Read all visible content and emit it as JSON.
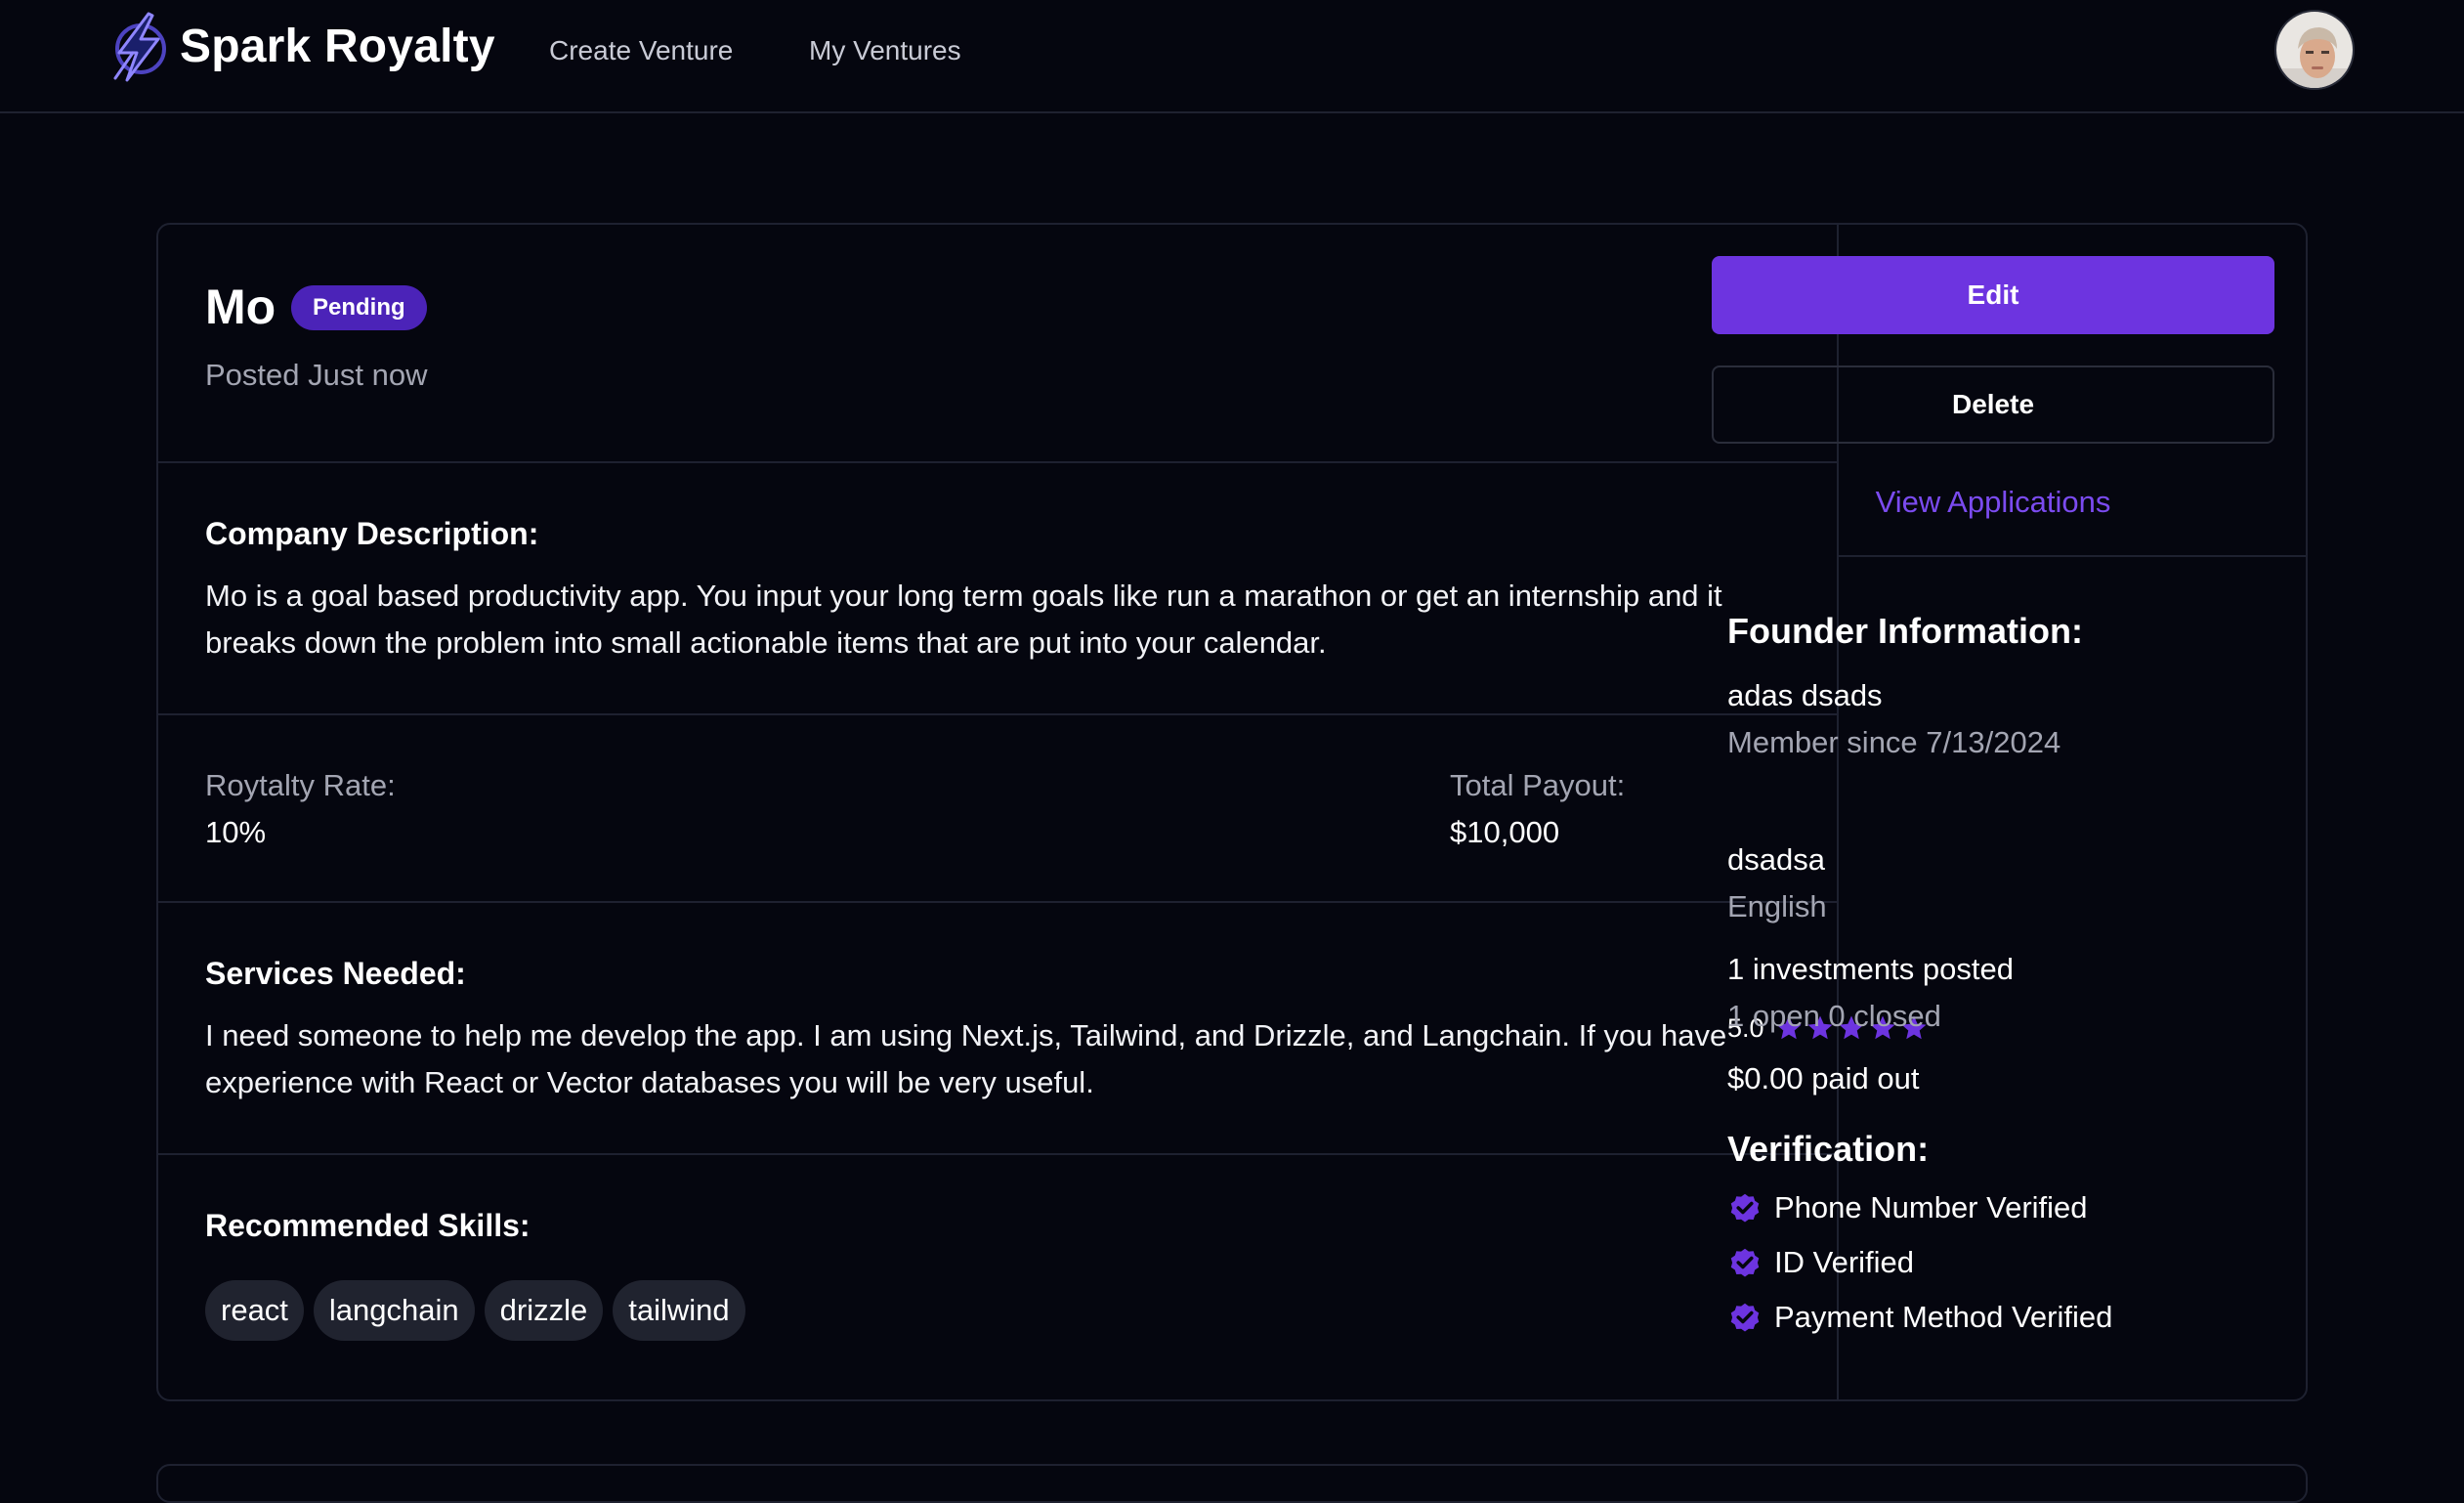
{
  "nav": {
    "brand": "Spark Royalty",
    "links": [
      "Create Venture",
      "My Ventures"
    ]
  },
  "venture": {
    "title": "Mo",
    "status": "Pending",
    "posted": "Posted Just now",
    "company_description_heading": "Company Description:",
    "company_description": "Mo is a goal based productivity app. You input your long term goals like run a marathon or get an internship and it breaks down the problem into small actionable items that are put into your calendar.",
    "royalty_label": "Roytalty Rate:",
    "royalty_value": "10%",
    "payout_label": "Total Payout:",
    "payout_value": "$10,000",
    "services_heading": "Services Needed:",
    "services": "I need someone to help me develop the app. I am using Next.js, Tailwind, and Drizzle, and Langchain. If you have experience with React or Vector databases you will be very useful.",
    "skills_heading": "Recommended Skills:",
    "skills": [
      "react",
      "langchain",
      "drizzle",
      "tailwind"
    ]
  },
  "actions": {
    "edit": "Edit",
    "delete": "Delete",
    "view_applications": "View Applications"
  },
  "founder": {
    "heading": "Founder Information:",
    "name": "adas dsads",
    "member_since": "Member since 7/13/2024",
    "rating": "5.0",
    "rating_stars": 5,
    "location": "dsadsa",
    "language": "English",
    "investments_posted": "1 investments posted",
    "open_closed": "1 open 0 closed",
    "paid_out": "$0.00 paid out"
  },
  "verification": {
    "heading": "Verification:",
    "items": [
      "Phone Number Verified",
      "ID Verified",
      "Payment Method Verified"
    ]
  },
  "colors": {
    "background": "#05060f",
    "accent": "#6d34e0",
    "badge": "#4b23b8",
    "link": "#7b4bf0",
    "border": "#1e2130",
    "muted_text": "#a3a5b2"
  },
  "icons": {
    "logo": "lightning-bolt-icon",
    "star": "star-icon",
    "verified": "verified-check-icon"
  }
}
